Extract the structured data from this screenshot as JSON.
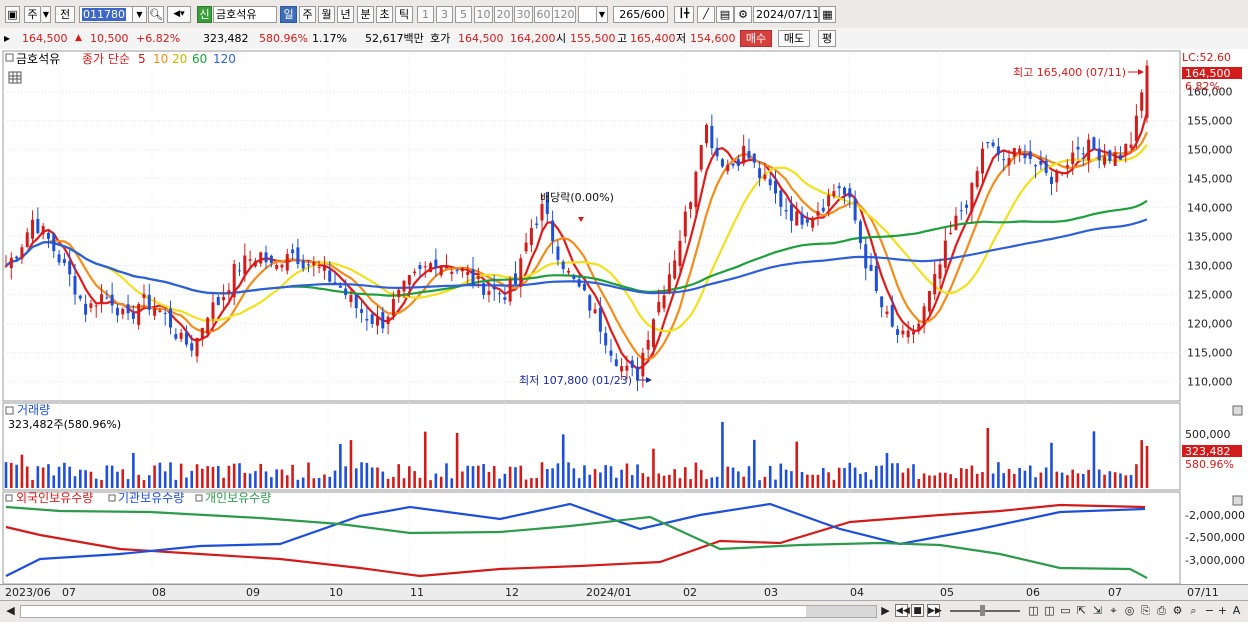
{
  "toolbar": {
    "mode_btn": "주",
    "prev_btn": "전",
    "code": "011780",
    "badge_new": "신",
    "stock_name": "금호석유",
    "period_tabs": [
      "일",
      "주",
      "월",
      "년",
      "분",
      "초",
      "틱"
    ],
    "active_period": "일",
    "intervals": [
      "1",
      "3",
      "5",
      "10",
      "20",
      "30",
      "60",
      "120"
    ],
    "count_display": "265",
    "count_total": "/600",
    "date": "2024/07/11"
  },
  "quote": {
    "price": "164,500",
    "change": "10,500",
    "change_pct": "+6.82%",
    "volume": "323,482",
    "volume_ratio": "580.96%",
    "turnover": "1.17%",
    "amount": "52,617백만",
    "ask_label": "호가",
    "ask": "164,500",
    "bid": "164,200",
    "open_label": "시",
    "open": "155,500",
    "high_label": "고",
    "high": "165,400",
    "low_label": "저",
    "low": "154,600",
    "buy_btn": "매수",
    "sell_btn": "매도",
    "eval_btn": "평"
  },
  "price_panel": {
    "legend_name": "금호석유",
    "legend_series": "종가 단순",
    "ma_periods": [
      "5",
      "10",
      "20",
      "60",
      "120"
    ],
    "ma_colors": [
      "#e01b1b",
      "#f28c1c",
      "#f0e020",
      "#1e9e3c",
      "#2f5fd8"
    ],
    "lc_label": "LC:52.60",
    "last_price_tag": "164,500",
    "last_pct_tag": "6.82%",
    "high_annotation": "최고 165,400 (07/11)",
    "low_annotation": "최저 107,800 (01/23)",
    "dividend_annotation": "배당락(0.00%)",
    "y_ticks": [
      "160,000",
      "155,000",
      "150,000",
      "145,000",
      "140,000",
      "135,000",
      "130,000",
      "125,000",
      "120,000",
      "115,000",
      "110,000"
    ]
  },
  "volume_panel": {
    "title": "거래량",
    "subtitle": "323,482주(580.96%)",
    "y_tick": "500,000",
    "last_tag": "323,482",
    "last_pct_tag": "580.96%"
  },
  "holdings_panel": {
    "legend": [
      "외국인보유수량",
      "기관보유수량",
      "개인보유수량"
    ],
    "legend_colors": [
      "#d21c1c",
      "#1e4fd8",
      "#2e9a4c"
    ],
    "y_ticks": [
      "-2,000,000",
      "-2,500,000",
      "-3,000,000"
    ]
  },
  "x_axis": {
    "labels": [
      "2023/06",
      "07",
      "08",
      "09",
      "10",
      "11",
      "12",
      "2024/01",
      "02",
      "03",
      "04",
      "05",
      "06",
      "07"
    ],
    "right_label": "07/11"
  },
  "chart_data": {
    "type": "candlestick",
    "x_range": [
      "2023/06",
      "2024/07/11"
    ],
    "ylim": [
      107000,
      167000
    ],
    "high": {
      "value": 165400,
      "date": "07/11"
    },
    "low": {
      "value": 107800,
      "date": "01/23"
    },
    "closing_prices_approx": [
      130000,
      133000,
      138000,
      135000,
      131000,
      127000,
      122000,
      125000,
      124000,
      120000,
      124000,
      123000,
      121000,
      117000,
      116000,
      122000,
      124000,
      129000,
      131000,
      132000,
      129000,
      133000,
      131000,
      130000,
      128000,
      126000,
      123000,
      121000,
      120000,
      124000,
      127000,
      129000,
      131000,
      130000,
      129000,
      127000,
      126000,
      125000,
      127000,
      136000,
      140000,
      133000,
      128000,
      125000,
      121000,
      116000,
      112000,
      111000,
      120000,
      126000,
      133000,
      142000,
      155000,
      149000,
      147000,
      150000,
      146000,
      143000,
      140000,
      138000,
      139000,
      141000,
      144000,
      140000,
      131000,
      124000,
      119000,
      117000,
      120000,
      126000,
      133000,
      139000,
      143000,
      152000,
      148000,
      149000,
      150000,
      146000,
      145000,
      148000,
      151000,
      150000,
      149000,
      149000,
      152000,
      164500
    ]
  }
}
